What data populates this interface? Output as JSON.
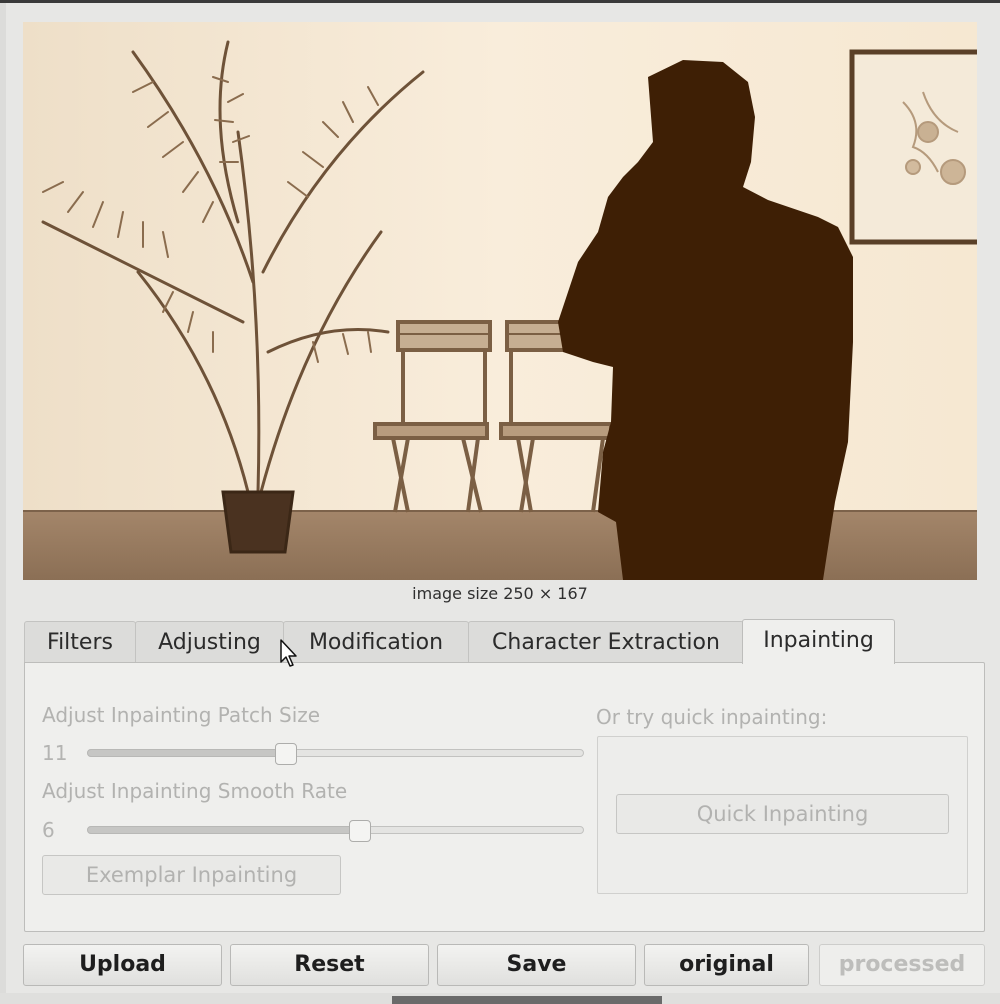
{
  "image": {
    "caption": "image size 250 × 167",
    "icon": "sepia-photo-with-silhouette"
  },
  "tabs": [
    {
      "label": "Filters",
      "active": false
    },
    {
      "label": "Adjusting",
      "active": false
    },
    {
      "label": "Modification",
      "active": false
    },
    {
      "label": "Character Extraction",
      "active": false
    },
    {
      "label": "Inpainting",
      "active": true
    }
  ],
  "inpainting": {
    "patch_label": "Adjust Inpainting Patch Size",
    "patch_value": "11",
    "patch_fraction": 0.4,
    "smooth_label": "Adjust Inpainting Smooth Rate",
    "smooth_value": "6",
    "smooth_fraction": 0.55,
    "exemplar_button": "Exemplar Inpainting",
    "quick_label": "Or try quick inpainting:",
    "quick_button": "Quick Inpainting"
  },
  "buttons": {
    "upload": "Upload",
    "reset": "Reset",
    "save": "Save",
    "original": "original",
    "processed": "processed"
  },
  "colors": {
    "sepia_light": "#f7ead7",
    "silhouette": "#3e1f05"
  }
}
